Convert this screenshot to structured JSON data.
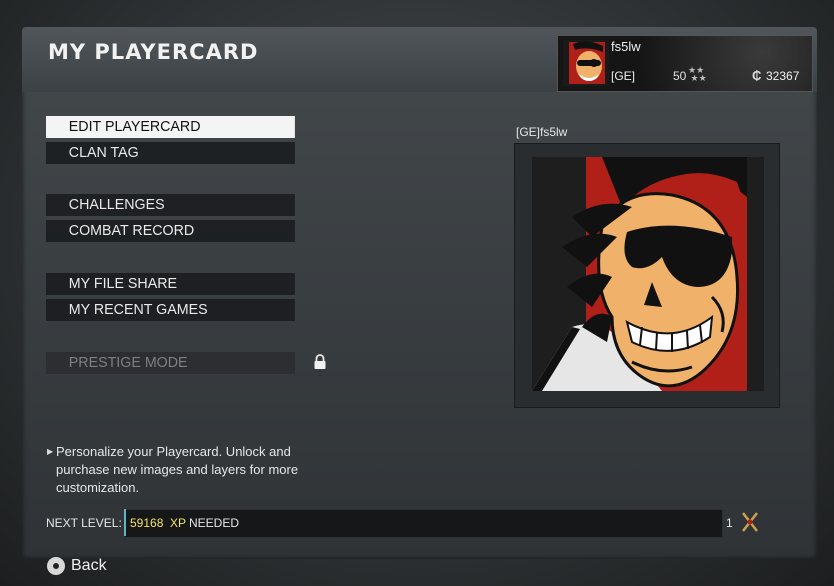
{
  "page": {
    "title": "MY PLAYERCARD"
  },
  "player_banner": {
    "name": "fs5lw",
    "clan_tag": "[GE]",
    "level": "50",
    "cod_points": "32367",
    "emblem_icon": "pirate-skull-emblem",
    "currency_icon": "cod-points-icon"
  },
  "menu": {
    "items": [
      {
        "label": "EDIT PLAYERCARD",
        "state": "selected"
      },
      {
        "label": "CLAN TAG",
        "state": "normal"
      },
      {
        "label": "CHALLENGES",
        "state": "normal"
      },
      {
        "label": "COMBAT RECORD",
        "state": "normal"
      },
      {
        "label": "MY FILE SHARE",
        "state": "normal"
      },
      {
        "label": "MY RECENT GAMES",
        "state": "normal"
      },
      {
        "label": "PRESTIGE MODE",
        "state": "disabled",
        "icon": "lock-icon"
      }
    ]
  },
  "preview": {
    "caption": "[GE]fs5lw",
    "emblem_icon": "pirate-skull-emblem"
  },
  "hint": {
    "text": "Personalize your Playercard. Unlock and purchase new images and layers for more customization."
  },
  "xp": {
    "label": "NEXT LEVEL:",
    "amount": "59168",
    "unit": "XP",
    "suffix": "NEEDED",
    "next_rank": "1",
    "rank_icon": "prestige-rank-icon"
  },
  "footer": {
    "back_label": "Back",
    "back_icon": "circle-button-icon"
  },
  "colors": {
    "xp_highlight": "#f2e36a",
    "selected_bg": "#f4f4f4",
    "emblem_red": "#b01f18",
    "emblem_skin": "#f0b26a"
  }
}
